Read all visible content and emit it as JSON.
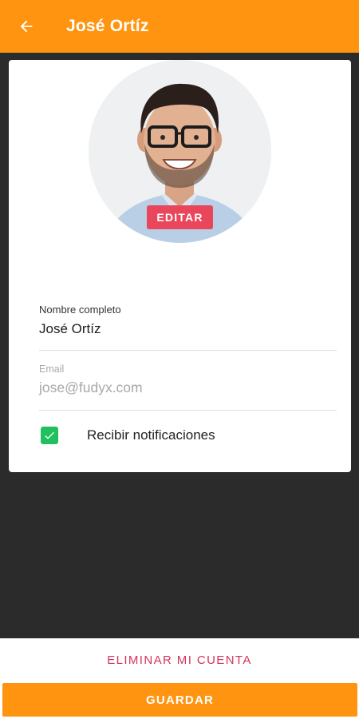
{
  "header": {
    "back_icon": "arrow-left-icon",
    "title": "José Ortíz"
  },
  "profile": {
    "avatar": "profile-photo",
    "edit_label": "EDITAR"
  },
  "form": {
    "name_label": "Nombre completo",
    "name_value": "José Ortíz",
    "email_label": "Email",
    "email_value": "jose@fudyx.com",
    "notifications_label": "Recibir notificaciones",
    "notifications_checked": true
  },
  "actions": {
    "delete_label": "ELIMINAR MI CUENTA",
    "save_label": "GUARDAR"
  },
  "colors": {
    "primary": "#ff9411",
    "edit_button": "#e9465b",
    "checkbox": "#20c05f",
    "danger_text": "#d4345a",
    "background": "#2b2b2b"
  }
}
